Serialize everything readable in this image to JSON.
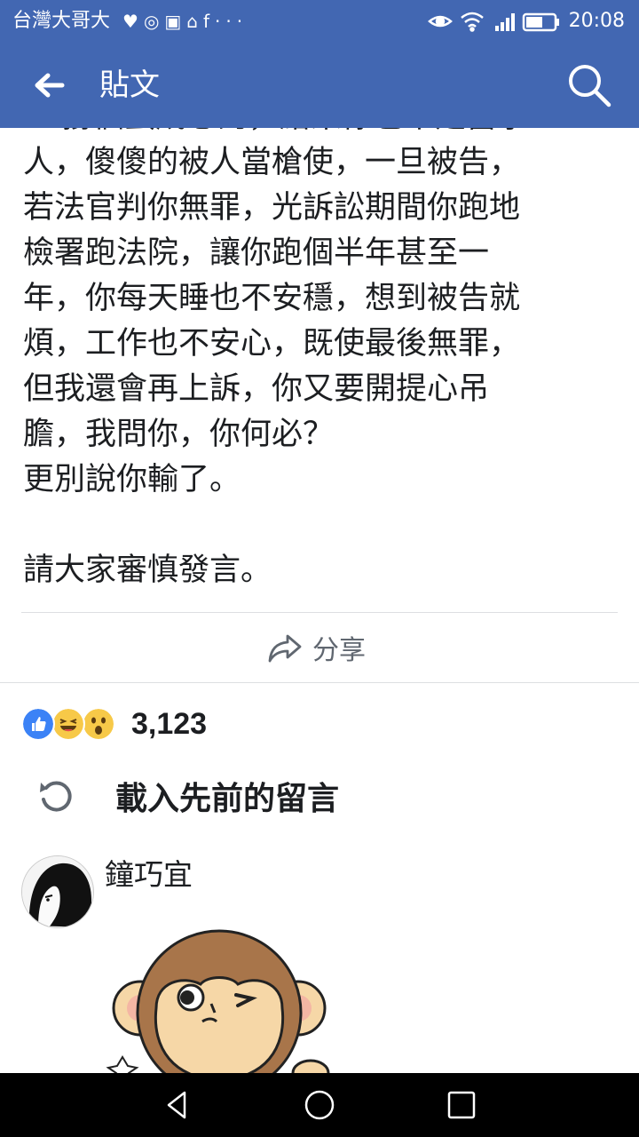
{
  "status_bar": {
    "carrier": "台灣大哥大",
    "notification_icons": [
      "heart-pulse-icon",
      "chrome-icon",
      "app-icon",
      "broom-icon",
      "facebook-icon",
      "more-icon"
    ],
    "overflow": "···",
    "system_icons": [
      "eye-icon",
      "wifi-icon",
      "signal-icon",
      "battery-icon"
    ],
    "time": "20:08"
  },
  "app_bar": {
    "title": "貼文",
    "back_icon": "back-arrow-icon",
    "search_icon": "search-icon"
  },
  "post": {
    "lines": [
      "PK撐個蛋成思的，結果你也不是當事",
      "人，傻傻的被人當槍使，一旦被告，",
      "若法官判你無罪，光訴訟期間你跑地",
      "檢署跑法院，讓你跑個半年甚至一",
      "年，你每天睡也不安穩，想到被告就",
      "煩，工作也不安心，既使最後無罪，",
      "但我還會再上訴，你又要開提心吊",
      "膽，我問你，你何必？",
      "更別說你輸了。"
    ],
    "closing_line": "請大家審慎發言。"
  },
  "actions": {
    "share_label": "分享"
  },
  "reactions": {
    "types": [
      "like",
      "haha",
      "wow"
    ],
    "count": "3,123"
  },
  "comments": {
    "load_previous_label": "載入先前的留言",
    "items": [
      {
        "author": "鐘巧宜",
        "attachment": "monkey-sticker"
      }
    ]
  },
  "colors": {
    "facebook_blue": "#4267b2",
    "text": "#1c1e21",
    "secondary_text": "#606770",
    "divider": "#dddfe2"
  },
  "nav_bar": {
    "buttons": [
      "back-triangle-icon",
      "home-circle-icon",
      "recents-square-icon"
    ]
  }
}
